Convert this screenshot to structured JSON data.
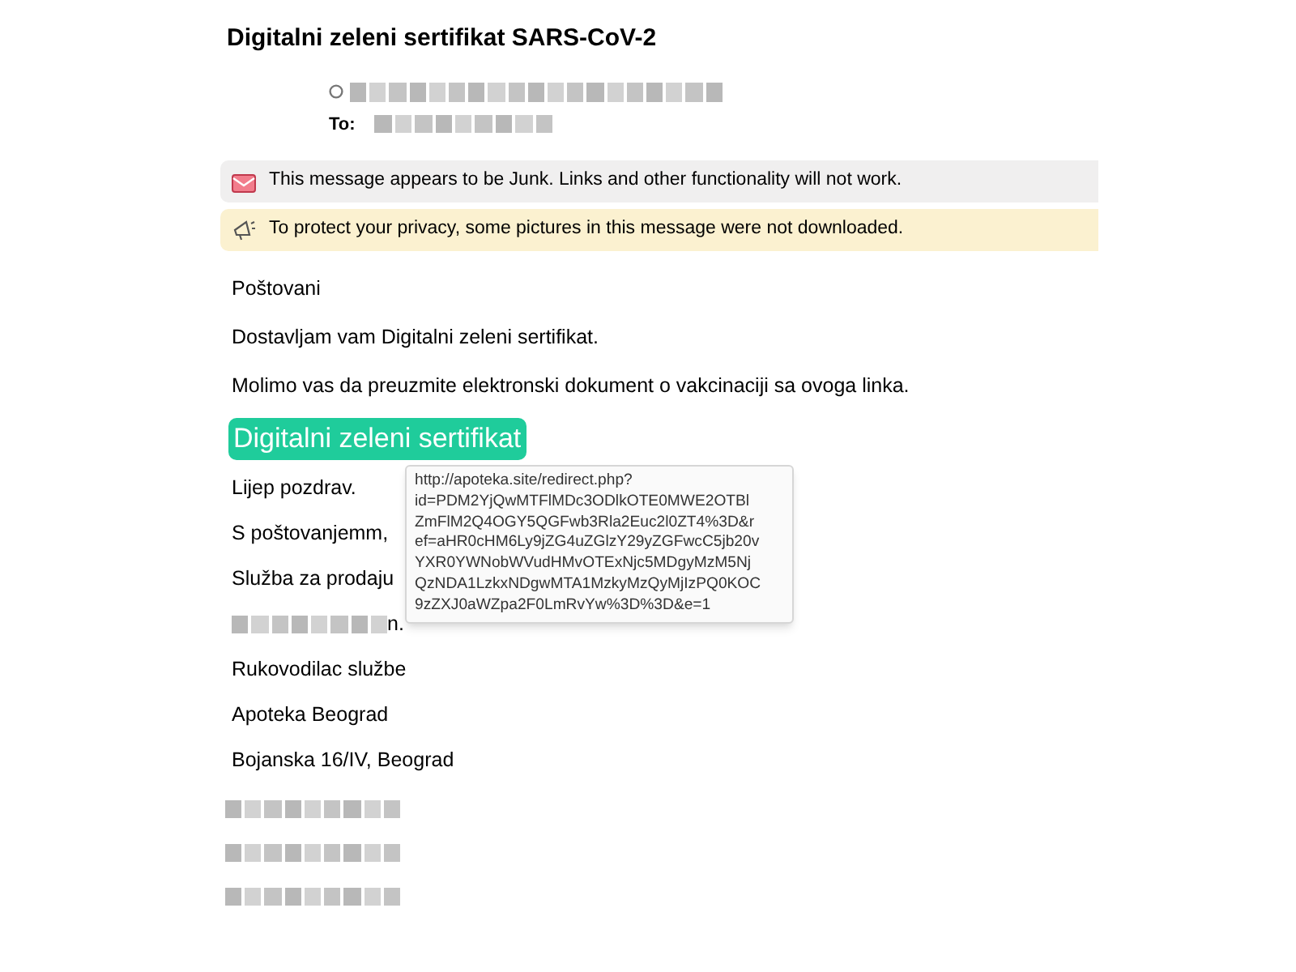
{
  "subject": "Digitalni zeleni sertifikat SARS-CoV-2",
  "header": {
    "to_label": "To:"
  },
  "banners": [
    {
      "kind": "junk",
      "text": "This message appears to be Junk. Links and other functionality will not work."
    },
    {
      "kind": "privacy",
      "text": "To protect your privacy, some pictures in this message were not downloaded."
    }
  ],
  "body": {
    "greeting": "Poštovani",
    "paragraphs": [
      "Dostavljam vam Digitalni zeleni sertifikat.",
      "Molimo vas da preuzmite elektronski dokument o vakcinaciji sa ovoga linka."
    ],
    "link_button": "Digitalni zeleni sertifikat",
    "closing": [
      "Lijep pozdrav.",
      "S poštovanjemm,",
      "Služba za prodaju"
    ],
    "name_suffix": "n.",
    "signature": [
      "Rukovodilac službe",
      "Apoteka Beograd",
      "Bojanska 16/IV, Beograd"
    ]
  },
  "tooltip": {
    "url_lines": [
      "http://apoteka.site/redirect.php?",
      "id=PDM2YjQwMTFlMDc3ODlkOTE0MWE2OTBl",
      "ZmFlM2Q4OGY5QGFwb3Rla2Euc2l0ZT4%3D&r",
      "ef=aHR0cHM6Ly9jZG4uZGlzY29yZGFwcC5jb20v",
      "YXR0YWNobWVudHMvOTExNjc5MDgyMzM5Nj",
      "QzNDA1LzkxNDgwMTA1MzkyMzQyMjIzPQ0KOC",
      "9zZXJ0aWZpa2F0LmRvYw%3D%3D&e=1"
    ]
  }
}
